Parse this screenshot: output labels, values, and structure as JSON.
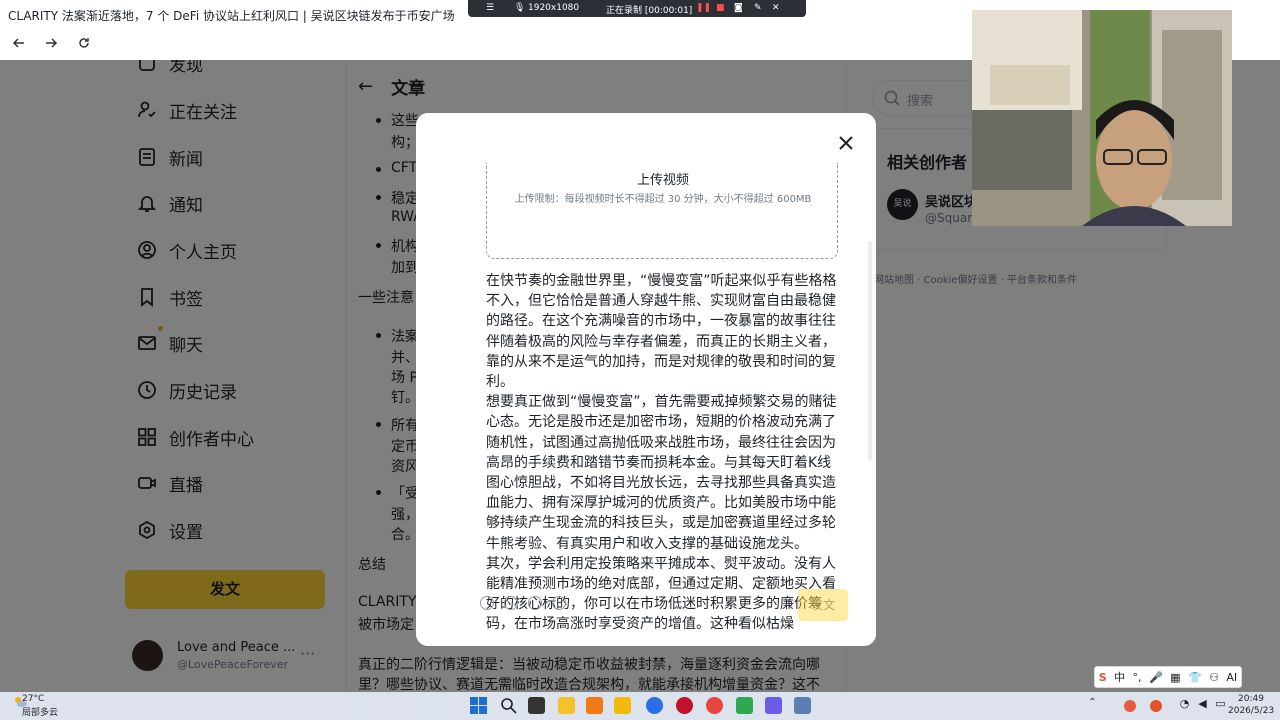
{
  "window": {
    "title": "CLARITY 法案渐近落地，7 个 DeFi 协议站上红利风口 | 吴说区块链发布于币安广场"
  },
  "recorder": {
    "resolution": "1920x1080",
    "status": "正在录制 [00:00:01]"
  },
  "sidebar": {
    "items": [
      {
        "label": "发现",
        "icon": "discover-icon"
      },
      {
        "label": "正在关注",
        "icon": "following-icon"
      },
      {
        "label": "新闻",
        "icon": "news-icon"
      },
      {
        "label": "通知",
        "icon": "bell-icon"
      },
      {
        "label": "个人主页",
        "icon": "profile-icon"
      },
      {
        "label": "书签",
        "icon": "bookmark-icon"
      },
      {
        "label": "聊天",
        "icon": "mail-icon"
      },
      {
        "label": "历史记录",
        "icon": "history-icon"
      },
      {
        "label": "创作者中心",
        "icon": "grid-icon"
      },
      {
        "label": "直播",
        "icon": "live-icon"
      },
      {
        "label": "设置",
        "icon": "settings-icon"
      }
    ],
    "post_button": "发文",
    "profile": {
      "name": "Love and Peace ...",
      "handle": "@LovePeaceForever"
    }
  },
  "article": {
    "heading": "文章",
    "lines": [
      "这些",
      "构；",
      "CFT",
      "稳定",
      "RWA",
      "机构",
      "加到",
      "一些注意",
      "法案",
      "并、",
      "场 P",
      "钉。",
      "所有",
      "定币",
      "资风",
      "「受",
      "强，",
      "合。",
      "总结",
      "CLARITY",
      "被市场定",
      "真正的二阶行情逻辑是：当被动稳定币收益被封禁，海量逐利资金会流向哪",
      "里？哪些协议、赛道无需临时改造合规架构，就能承接机构增量资金？这不"
    ]
  },
  "right": {
    "search_placeholder": "搜索",
    "creators_title": "相关创作者",
    "creator_avatar_text": "吴说",
    "creator_name": "吴说区块",
    "creator_handle": "@Square",
    "footer": "网站地图 · Cookie偏好设置 · 平台条款和条件"
  },
  "modal": {
    "upload_title": "上传视频",
    "upload_limit": "上传限制：每段视频时长不得超过 30 分钟，大小不得超过 600MB",
    "paragraphs": [
      "在快节奏的金融世界里，“慢慢变富”听起来似乎有些格格不入，但它恰恰是普通人穿越牛熊、实现财富自由最稳健的路径。在这个充满噪音的市场中，一夜暴富的故事往往伴随着极高的风险与幸存者偏差，而真正的长期主义者，靠的从来不是运气的加持，而是对规律的敬畏和时间的复利。",
      "想要真正做到“慢慢变富”，首先需要戒掉频繁交易的赌徒心态。无论是股市还是加密市场，短期的价格波动充满了随机性，试图通过高抛低吸来战胜市场，最终往往会因为高昂的手续费和踏错节奏而损耗本金。与其每天盯着K线图心惊胆战，不如将目光放长远，去寻找那些具备真实造血能力、拥有深厚护城河的优质资产。比如美股市场中能够持续产生现金流的科技巨头，或是加密赛道里经过多轮牛熊考验、有真实用户和收入支撑的基础设施龙头。",
      "其次，学会利用定投策略来平摊成本、熨平波动。没有人能精准预测市场的绝对底部，但通过定期、定额地买入看好的核心标的，你可以在市场低迷时积累更多的廉价筹码，在市场高涨时享受资产的增值。这种看似枯燥"
    ],
    "post_button": "发文"
  },
  "ime": {
    "items": [
      "S",
      "中",
      "°,",
      "🎤",
      "▦",
      "👕",
      "⚇",
      "AI"
    ]
  },
  "taskbar": {
    "temperature": "27°C",
    "weather": "局部多云",
    "time": "20:49",
    "date": "2026/5/23"
  }
}
